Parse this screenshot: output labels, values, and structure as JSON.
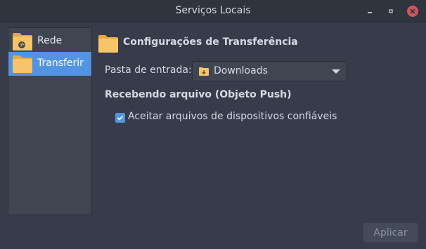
{
  "window": {
    "title": "Serviços Locais"
  },
  "sidebar": {
    "items": [
      {
        "label": "Rede",
        "icon": "folder-network-icon",
        "selected": false
      },
      {
        "label": "Transferir",
        "icon": "folder-icon",
        "selected": true
      }
    ]
  },
  "transfer": {
    "section_title": "Configurações de Transferência",
    "incoming_folder_label": "Pasta de entrada:",
    "incoming_folder_value": "Downloads",
    "receiving_title": "Recebendo arquivo (Objeto Push)",
    "accept_trusted_label": "Aceitar arquivos de dispositivos confiáveis",
    "accept_trusted_checked": true
  },
  "footer": {
    "apply_label": "Aplicar"
  },
  "colors": {
    "accent": "#5294e2",
    "folder": "#f5c46b",
    "close": "#cc575d"
  }
}
